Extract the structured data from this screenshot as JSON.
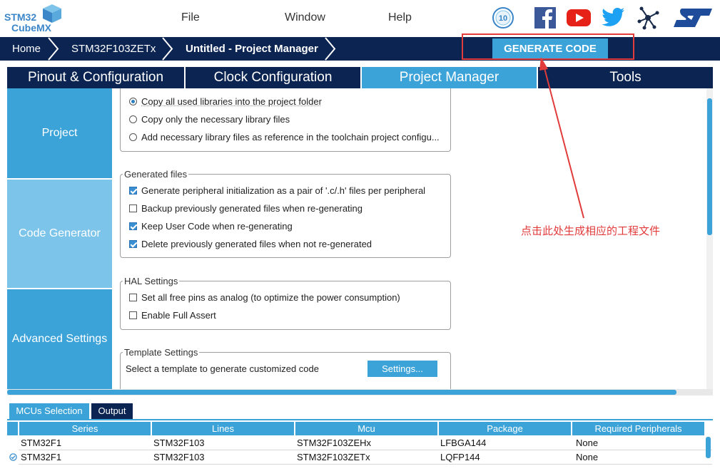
{
  "logo": {
    "line1": "STM32",
    "line2": "CubeMX"
  },
  "menu": [
    "File",
    "Window",
    "Help"
  ],
  "social_icons": [
    "anniversary-10-icon",
    "facebook-icon",
    "youtube-icon",
    "twitter-icon",
    "network-icon",
    "st-logo-icon"
  ],
  "badge_text": "10",
  "breadcrumb": [
    "Home",
    "STM32F103ZETx",
    "Untitled - Project Manager"
  ],
  "generate_button": "GENERATE CODE",
  "tabs": [
    "Pinout & Configuration",
    "Clock Configuration",
    "Project Manager",
    "Tools"
  ],
  "active_tab": "Project Manager",
  "left_nav": [
    "Project",
    "Code Generator",
    "Advanced Settings"
  ],
  "library_options": [
    {
      "label": "Copy all used libraries into the project folder",
      "selected": true
    },
    {
      "label": "Copy only the necessary library files",
      "selected": false
    },
    {
      "label": "Add necessary library files as reference in the toolchain project configu...",
      "selected": false
    }
  ],
  "generated_files": {
    "title": "Generated files",
    "options": [
      {
        "label": "Generate peripheral initialization as a pair of '.c/.h' files per peripheral",
        "checked": true
      },
      {
        "label": "Backup previously generated files when re-generating",
        "checked": false
      },
      {
        "label": "Keep User Code when re-generating",
        "checked": true
      },
      {
        "label": "Delete previously generated files when not re-generated",
        "checked": true
      }
    ]
  },
  "hal_settings": {
    "title": "HAL Settings",
    "options": [
      {
        "label": "Set all free pins as analog (to optimize the power consumption)",
        "checked": false
      },
      {
        "label": "Enable Full Assert",
        "checked": false
      }
    ]
  },
  "template_settings": {
    "title": "Template Settings",
    "text": "Select a template to generate customized code",
    "button": "Settings..."
  },
  "annotation": "点击此处生成相应的工程文件",
  "bottom_tabs": [
    "MCUs Selection",
    "Output"
  ],
  "table": {
    "headers": [
      "Series",
      "Lines",
      "Mcu",
      "Package",
      "Required Peripherals"
    ],
    "rows": [
      [
        "STM32F1",
        "STM32F103",
        "STM32F103ZEHx",
        "LFBGA144",
        "None"
      ],
      [
        "STM32F1",
        "STM32F103",
        "STM32F103ZETx",
        "LQFP144",
        "None"
      ]
    ]
  },
  "colors": {
    "navy": "#0b2451",
    "accent": "#3ba3d8",
    "annotation": "#e23b3b"
  }
}
